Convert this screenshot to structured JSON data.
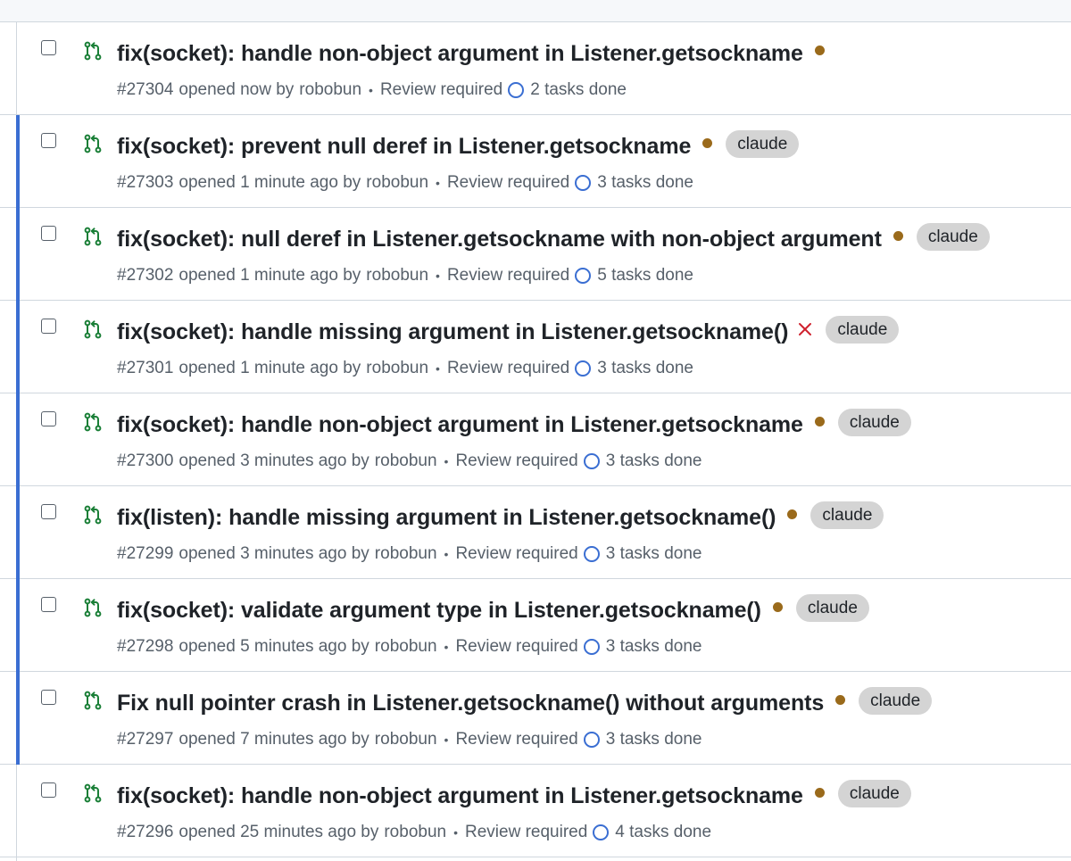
{
  "colors": {
    "pending_dot": "#9a6a1b",
    "fail_x": "#cf222e",
    "label_bg": "#d4d4d4",
    "pr_open_icon": "#1a7f37",
    "unread_bar": "#3a6ed2",
    "task_circle": "#3a6ed2"
  },
  "pull_requests": [
    {
      "title": "fix(socket): handle non-object argument in Listener.getsockname",
      "number": "#27304",
      "opened_text": "opened now by",
      "author": "robobun",
      "separator": "•",
      "review": "Review required",
      "tasks": "2 tasks done",
      "status": "pending",
      "label": "",
      "unread": false
    },
    {
      "title": "fix(socket): prevent null deref in Listener.getsockname",
      "number": "#27303",
      "opened_text": "opened 1 minute ago by",
      "author": "robobun",
      "separator": "•",
      "review": "Review required",
      "tasks": "3 tasks done",
      "status": "pending",
      "label": "claude",
      "unread": true
    },
    {
      "title": "fix(socket): null deref in Listener.getsockname with non-object argument",
      "number": "#27302",
      "opened_text": "opened 1 minute ago by",
      "author": "robobun",
      "separator": "•",
      "review": "Review required",
      "tasks": "5 tasks done",
      "status": "pending",
      "label": "claude",
      "unread": true
    },
    {
      "title": "fix(socket): handle missing argument in Listener.getsockname()",
      "number": "#27301",
      "opened_text": "opened 1 minute ago by",
      "author": "robobun",
      "separator": "•",
      "review": "Review required",
      "tasks": "3 tasks done",
      "status": "failure",
      "label": "claude",
      "unread": true
    },
    {
      "title": "fix(socket): handle non-object argument in Listener.getsockname",
      "number": "#27300",
      "opened_text": "opened 3 minutes ago by",
      "author": "robobun",
      "separator": "•",
      "review": "Review required",
      "tasks": "3 tasks done",
      "status": "pending",
      "label": "claude",
      "unread": true
    },
    {
      "title": "fix(listen): handle missing argument in Listener.getsockname()",
      "number": "#27299",
      "opened_text": "opened 3 minutes ago by",
      "author": "robobun",
      "separator": "•",
      "review": "Review required",
      "tasks": "3 tasks done",
      "status": "pending",
      "label": "claude",
      "unread": true
    },
    {
      "title": "fix(socket): validate argument type in Listener.getsockname()",
      "number": "#27298",
      "opened_text": "opened 5 minutes ago by",
      "author": "robobun",
      "separator": "•",
      "review": "Review required",
      "tasks": "3 tasks done",
      "status": "pending",
      "label": "claude",
      "unread": true
    },
    {
      "title": "Fix null pointer crash in Listener.getsockname() without arguments",
      "number": "#27297",
      "opened_text": "opened 7 minutes ago by",
      "author": "robobun",
      "separator": "•",
      "review": "Review required",
      "tasks": "3 tasks done",
      "status": "pending",
      "label": "claude",
      "unread": true
    },
    {
      "title": "fix(socket): handle non-object argument in Listener.getsockname",
      "number": "#27296",
      "opened_text": "opened 25 minutes ago by",
      "author": "robobun",
      "separator": "•",
      "review": "Review required",
      "tasks": "4 tasks done",
      "status": "pending",
      "label": "claude",
      "unread": false
    }
  ]
}
